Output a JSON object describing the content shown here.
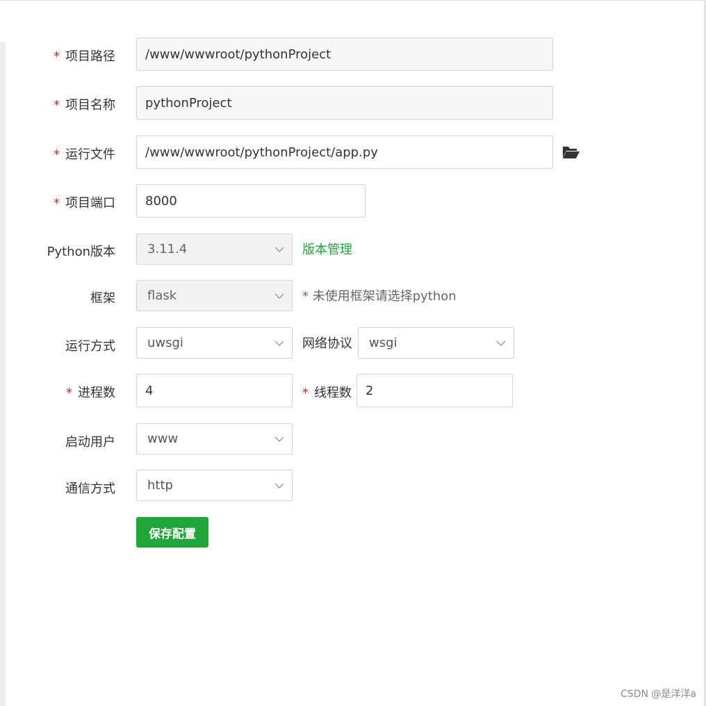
{
  "form": {
    "project_path": {
      "required": "*",
      "label": "项目路径",
      "value": "/www/wwwroot/pythonProject"
    },
    "project_name": {
      "required": "*",
      "label": "项目名称",
      "value": "pythonProject"
    },
    "run_file": {
      "required": "*",
      "label": "运行文件",
      "value": "/www/wwwroot/pythonProject/app.py",
      "icon": "folder-open-icon"
    },
    "project_port": {
      "required": "*",
      "label": "项目端口",
      "value": "8000"
    },
    "python_version": {
      "label": "Python版本",
      "value": "3.11.4",
      "link": "版本管理"
    },
    "framework": {
      "label": "框架",
      "value": "flask",
      "hint": "* 未使用框架请选择python"
    },
    "run_mode": {
      "label": "运行方式",
      "value": "uwsgi"
    },
    "network_protocol": {
      "label": "网络协议",
      "value": "wsgi"
    },
    "processes": {
      "required": "*",
      "label": "进程数",
      "value": "4"
    },
    "threads": {
      "required": "*",
      "label": "线程数",
      "value": "2"
    },
    "start_user": {
      "label": "启动用户",
      "value": "www"
    },
    "comm_mode": {
      "label": "通信方式",
      "value": "http"
    },
    "save_label": "保存配置"
  },
  "watermark": "CSDN @是洋洋a",
  "colors": {
    "accent": "#20a53a",
    "required": "#e02020",
    "border": "#d5d5d5",
    "readonly_bg": "#f7f7f7"
  }
}
